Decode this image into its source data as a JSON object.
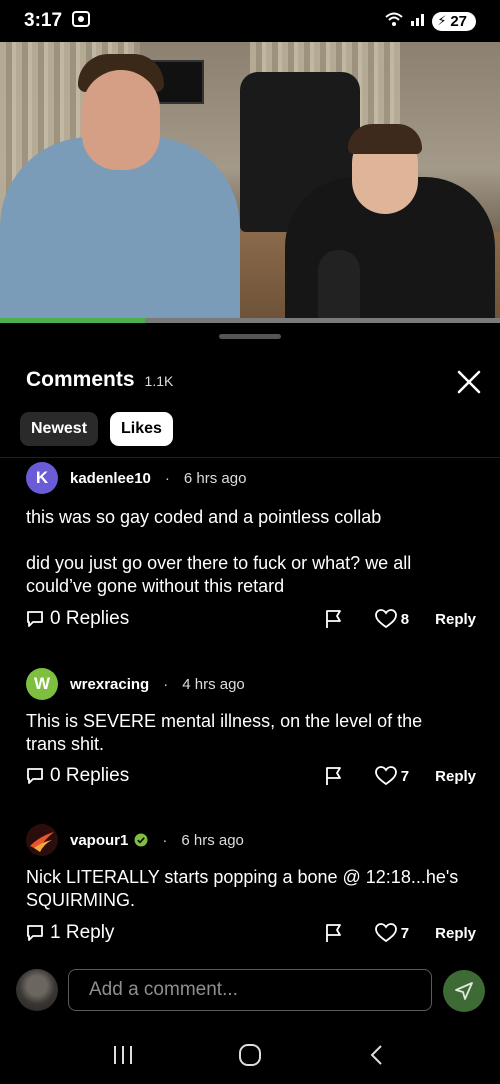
{
  "status_bar": {
    "time": "3:17",
    "battery": "27"
  },
  "video": {
    "progress_fraction": 0.29
  },
  "comments_header": {
    "title": "Comments",
    "count": "1.1K"
  },
  "sort_options": [
    {
      "label": "Newest",
      "active": false
    },
    {
      "label": "Likes",
      "active": true
    }
  ],
  "comments": [
    {
      "avatar_letter": "K",
      "avatar_color": "#6a5bd6",
      "username": "kadenlee10",
      "separator": "·",
      "time": "6 hrs ago",
      "text": "this was so gay coded and a pointless collab\n\ndid you just go over there to fuck or what? we all could’ve gone without this retard",
      "replies": "0 Replies",
      "likes": "8",
      "reply_label": "Reply"
    },
    {
      "avatar_letter": "W",
      "avatar_color": "#7fbf3f",
      "username": "wrexracing",
      "separator": "·",
      "time": "4 hrs ago",
      "text": "This is SEVERE mental illness, on the level of the trans shit.",
      "replies": "0 Replies",
      "likes": "7",
      "reply_label": "Reply"
    },
    {
      "avatar_letter": "",
      "avatar_color": "#2b0d0d",
      "username": "vapour1",
      "verified": true,
      "separator": "·",
      "time": "6 hrs ago",
      "text": "Nick LITERALLY  starts popping a bone @ 12:18...he's SQUIRMING.",
      "replies": "1 Reply",
      "likes": "7",
      "reply_label": "Reply"
    }
  ],
  "composer": {
    "placeholder": "Add a comment..."
  },
  "colors": {
    "accent_green": "#4caf50",
    "send_button": "#3d6a35"
  },
  "icons": {
    "close": "close-icon",
    "replies": "comment-bubble-icon",
    "flag": "flag-icon",
    "like": "heart-icon",
    "send": "send-icon",
    "nav": [
      "recent-apps-icon",
      "home-icon",
      "back-icon"
    ]
  }
}
